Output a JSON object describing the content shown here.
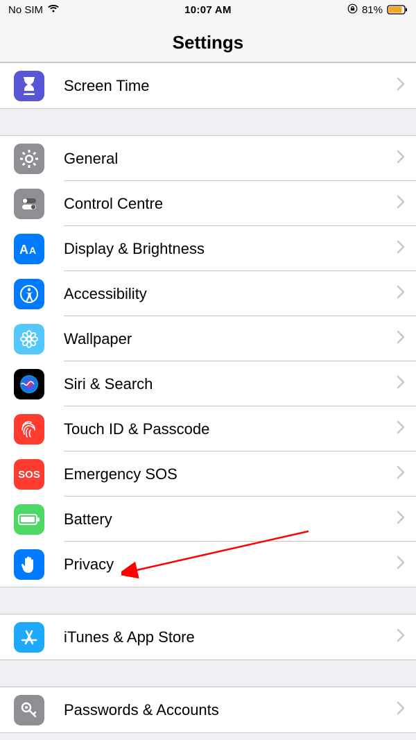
{
  "statusBar": {
    "sim": "No SIM",
    "time": "10:07 AM",
    "battery": "81%"
  },
  "header": {
    "title": "Settings"
  },
  "groups": [
    {
      "items": [
        {
          "id": "screen-time",
          "label": "Screen Time",
          "icon": "hourglass",
          "bg": "#5856d6",
          "fg": "#ffffff"
        }
      ]
    },
    {
      "items": [
        {
          "id": "general",
          "label": "General",
          "icon": "gear",
          "bg": "#8e8e93",
          "fg": "#ffffff"
        },
        {
          "id": "control-centre",
          "label": "Control Centre",
          "icon": "switches",
          "bg": "#8e8e93",
          "fg": "#ffffff"
        },
        {
          "id": "display-brightness",
          "label": "Display & Brightness",
          "icon": "aa",
          "bg": "#007aff",
          "fg": "#ffffff"
        },
        {
          "id": "accessibility",
          "label": "Accessibility",
          "icon": "accessibility",
          "bg": "#007aff",
          "fg": "#ffffff"
        },
        {
          "id": "wallpaper",
          "label": "Wallpaper",
          "icon": "flower",
          "bg": "#54c7fc",
          "fg": "#ffffff"
        },
        {
          "id": "siri-search",
          "label": "Siri & Search",
          "icon": "siri",
          "bg": "#000000",
          "fg": "#ffffff"
        },
        {
          "id": "touch-id",
          "label": "Touch ID & Passcode",
          "icon": "fingerprint",
          "bg": "#ff3b30",
          "fg": "#ffffff"
        },
        {
          "id": "emergency-sos",
          "label": "Emergency SOS",
          "icon": "sos",
          "bg": "#ff3b30",
          "fg": "#ffffff"
        },
        {
          "id": "battery",
          "label": "Battery",
          "icon": "battery",
          "bg": "#4cd964",
          "fg": "#ffffff"
        },
        {
          "id": "privacy",
          "label": "Privacy",
          "icon": "hand",
          "bg": "#007aff",
          "fg": "#ffffff"
        }
      ]
    },
    {
      "items": [
        {
          "id": "itunes-app-store",
          "label": "iTunes & App Store",
          "icon": "appstore",
          "bg": "#1eaafc",
          "fg": "#ffffff"
        }
      ]
    },
    {
      "items": [
        {
          "id": "passwords-accounts",
          "label": "Passwords & Accounts",
          "icon": "key",
          "bg": "#8e8e93",
          "fg": "#ffffff"
        }
      ]
    }
  ],
  "annotation": {
    "arrowTarget": "privacy"
  }
}
